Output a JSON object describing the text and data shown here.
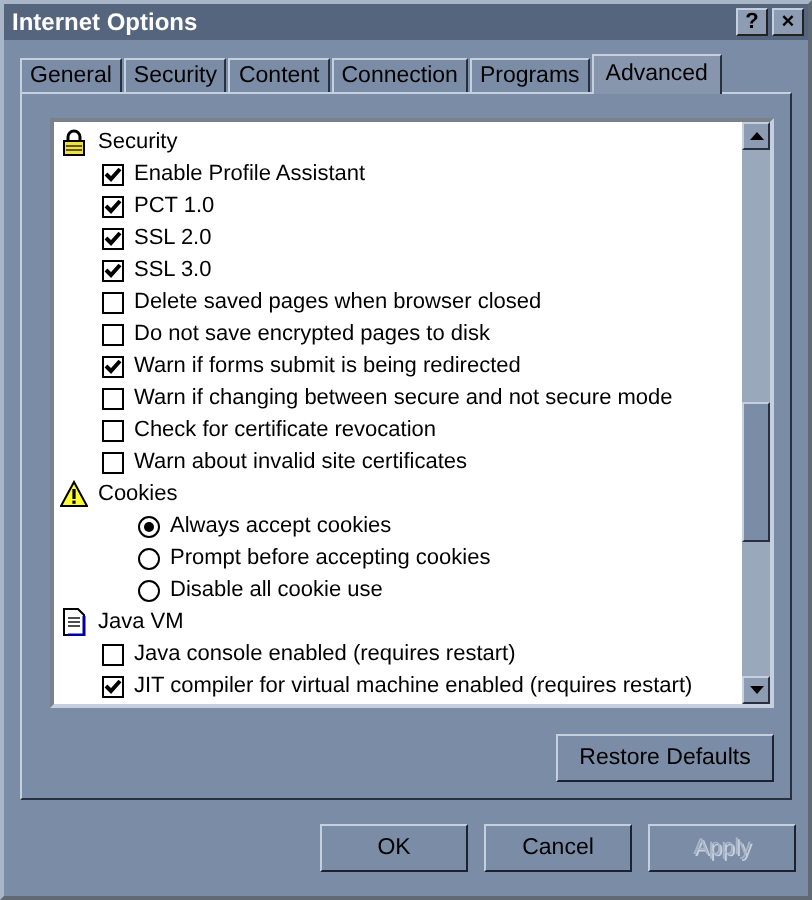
{
  "window": {
    "title": "Internet Options",
    "help_button": "?",
    "close_button": "×"
  },
  "tabs": [
    {
      "label": "General",
      "selected": false
    },
    {
      "label": "Security",
      "selected": false
    },
    {
      "label": "Content",
      "selected": false
    },
    {
      "label": "Connection",
      "selected": false
    },
    {
      "label": "Programs",
      "selected": false
    },
    {
      "label": "Advanced",
      "selected": true
    }
  ],
  "settings": [
    {
      "label": "Security",
      "children": [
        {
          "kind": "checkbox",
          "label": "Enable Profile Assistant",
          "checked": true
        },
        {
          "kind": "checkbox",
          "label": "PCT 1.0",
          "checked": true
        },
        {
          "kind": "checkbox",
          "label": "SSL 2.0",
          "checked": true
        },
        {
          "kind": "checkbox",
          "label": "SSL 3.0",
          "checked": true
        },
        {
          "kind": "checkbox",
          "label": "Delete saved pages when browser closed",
          "checked": false
        },
        {
          "kind": "checkbox",
          "label": "Do not save encrypted pages to disk",
          "checked": false
        },
        {
          "kind": "checkbox",
          "label": "Warn if forms submit is being redirected",
          "checked": true
        },
        {
          "kind": "checkbox",
          "label": "Warn if changing between secure and not secure mode",
          "checked": false
        },
        {
          "kind": "checkbox",
          "label": "Check for certificate revocation",
          "checked": false
        },
        {
          "kind": "checkbox",
          "label": "Warn about invalid site certificates",
          "checked": false
        }
      ]
    },
    {
      "label": "Cookies",
      "children": [
        {
          "kind": "radio",
          "label": "Always accept cookies",
          "selected": true
        },
        {
          "kind": "radio",
          "label": "Prompt before accepting cookies",
          "selected": false
        },
        {
          "kind": "radio",
          "label": "Disable all cookie use",
          "selected": false
        }
      ]
    },
    {
      "label": "Java VM",
      "children": [
        {
          "kind": "checkbox",
          "label": "Java console enabled (requires restart)",
          "checked": false
        },
        {
          "kind": "checkbox",
          "label": "JIT compiler for virtual machine enabled (requires restart)",
          "checked": true
        }
      ]
    }
  ],
  "restore_button": "Restore Defaults",
  "buttons": [
    {
      "label": "OK",
      "disabled": false
    },
    {
      "label": "Cancel",
      "disabled": false
    },
    {
      "label": "Apply",
      "disabled": true
    }
  ]
}
